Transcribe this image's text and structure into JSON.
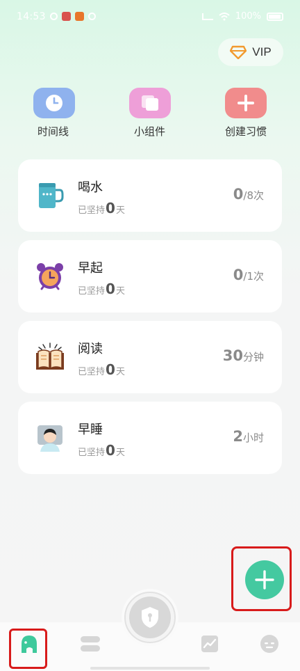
{
  "status_bar": {
    "time": "14:53",
    "battery": "100%"
  },
  "vip": {
    "label": "VIP",
    "icon": "diamond-icon",
    "color": "#f29a2e"
  },
  "quick_actions": [
    {
      "label": "时间线",
      "icon": "clock-icon",
      "color": "#8fb2ee"
    },
    {
      "label": "小组件",
      "icon": "widget-icon",
      "color": "#ee9fd8"
    },
    {
      "label": "创建习惯",
      "icon": "plus-icon",
      "color": "#f18c8c"
    }
  ],
  "habits": [
    {
      "name": "喝水",
      "streak_prefix": "已坚持",
      "streak_days": "0",
      "streak_suffix": "天",
      "goal_value": "0",
      "goal_unit": "/8次",
      "icon": "cup-icon"
    },
    {
      "name": "早起",
      "streak_prefix": "已坚持",
      "streak_days": "0",
      "streak_suffix": "天",
      "goal_value": "0",
      "goal_unit": "/1次",
      "icon": "alarm-clock-icon"
    },
    {
      "name": "阅读",
      "streak_prefix": "已坚持",
      "streak_days": "0",
      "streak_suffix": "天",
      "goal_value": "30",
      "goal_unit": "分钟",
      "icon": "book-icon"
    },
    {
      "name": "早睡",
      "streak_prefix": "已坚持",
      "streak_days": "0",
      "streak_suffix": "天",
      "goal_value": "2",
      "goal_unit": "小时",
      "icon": "sleeping-person-icon"
    }
  ],
  "fab": {
    "icon": "plus-icon",
    "color": "#44c9a0"
  },
  "bottom_nav": [
    {
      "name": "home",
      "icon": "elephant-icon",
      "active": true,
      "color": "#3ec99c"
    },
    {
      "name": "list",
      "icon": "list-icon",
      "active": false
    },
    {
      "name": "lock",
      "icon": "shield-lock-icon",
      "active": false
    },
    {
      "name": "stats",
      "icon": "chart-icon",
      "active": false
    },
    {
      "name": "profile",
      "icon": "face-icon",
      "active": false
    }
  ]
}
